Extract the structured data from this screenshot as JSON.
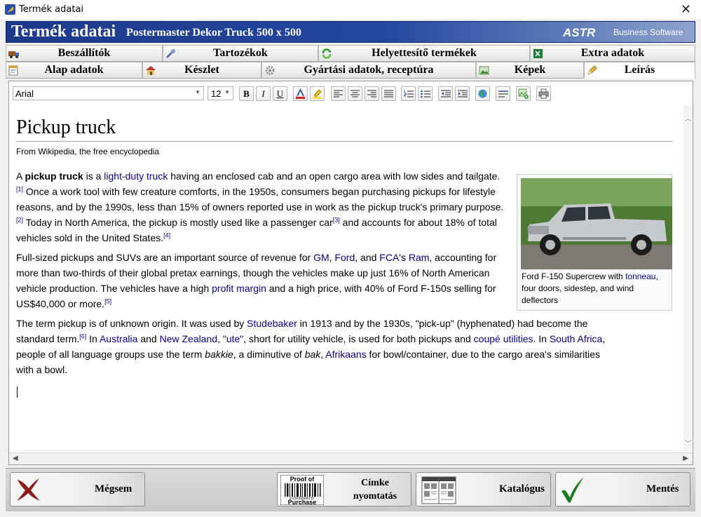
{
  "window": {
    "title": "Termék adatai",
    "close_glyph": "✕"
  },
  "header": {
    "title": "Termék adatai",
    "subtitle": "Postermaster Dekor Truck  500 x 500",
    "brand": "ASTR",
    "brand_sub": "Business Software"
  },
  "tabs_row1": [
    {
      "label": "Beszállítók",
      "icon": "truck-icon"
    },
    {
      "label": "Tartozékok",
      "icon": "wrench-icon"
    },
    {
      "label": "Helyettesítő termékek",
      "icon": "refresh-icon"
    },
    {
      "label": "Extra adatok",
      "icon": "excel-icon"
    }
  ],
  "tabs_row2": [
    {
      "label": "Alap adatok",
      "icon": "notepad-icon"
    },
    {
      "label": "Készlet",
      "icon": "house-icon"
    },
    {
      "label": "Gyártási adatok, receptúra",
      "icon": "gear-icon"
    },
    {
      "label": "Képek",
      "icon": "picture-icon"
    },
    {
      "label": "Leírás",
      "icon": "pencil-icon",
      "active": true
    }
  ],
  "editor": {
    "font": "Arial",
    "size": "12",
    "bold": "B",
    "italic": "I",
    "underline": "U",
    "article": {
      "title": "Pickup truck",
      "from": "From Wikipedia, the free encyclopedia",
      "p1": {
        "a": "A ",
        "b": "pickup truck",
        "c": " is a ",
        "d": "light-duty truck",
        "e": " having an enclosed cab and an open cargo area with low sides and tailgate.",
        "f": "[1]",
        "g": " Once a work tool with few creature comforts, in the 1950s, consumers began purchasing pickups for lifestyle reasons, and by the 1990s, less than 15% of owners reported use in work as the pickup truck's primary purpose.",
        "h": "[2]",
        "i": " Today in North America, the pickup is mostly used like a passenger car",
        "j": "[3]",
        "k": " and accounts for about 18% of total vehicles sold in the United States.",
        "l": "[4]"
      },
      "p2": {
        "a": "Full-sized pickups and SUVs are an important source of revenue for ",
        "b": "GM",
        "c": ", ",
        "d": "Ford",
        "e": ", and ",
        "f": "FCA",
        "g": "'s ",
        "h": "Ram",
        "i": ", accounting for more than two-thirds of their global pretax earnings, though the vehicles make up just 16% of North American vehicle production. The vehicles have a high ",
        "j": "profit margin",
        "k": " and a high price, with 40% of Ford F-150s selling for US$40,000 or more.",
        "l": "[5]"
      },
      "p3": {
        "a": "The term pickup is of unknown origin. It was used by ",
        "b": "Studebaker",
        "c": " in 1913 and by the 1930s, \"pick-up\" (hyphenated) had become the standard term.",
        "d": "[6]",
        "e": " In ",
        "f": "Australia",
        "g": " and ",
        "h": "New Zealand",
        "i": ", ",
        "j": "\"ute\"",
        "k": ", short for utility vehicle, is used for both pickups and ",
        "l": "coupé utilities",
        "m": ". In ",
        "n": "South Africa",
        "o": ", people of all language groups use the term ",
        "p": "bakkie",
        "q": ", a diminutive of ",
        "r": "bak",
        "s": ", ",
        "t": "Afrikaans",
        "u": " for bowl/container, due to the cargo area's similarities with a bowl."
      },
      "caption": {
        "a": "Ford F-150 Supercrew with ",
        "b": "tonneau",
        "c": ", four doors, sidestep, and wind deflectors"
      }
    }
  },
  "buttons": {
    "cancel": "Mégsem",
    "label_print": "Címke nyomtatás",
    "catalog": "Katalógus",
    "save": "Mentés",
    "barcode_top": "Proof of",
    "barcode_bottom": "Purchase",
    "barcode_digits": "0 630395043 97"
  },
  "colors": {
    "header": "#23479f",
    "link": "#0b0080",
    "save_check": "#1d7a1d",
    "cancel_x": "#8b1a1a"
  }
}
